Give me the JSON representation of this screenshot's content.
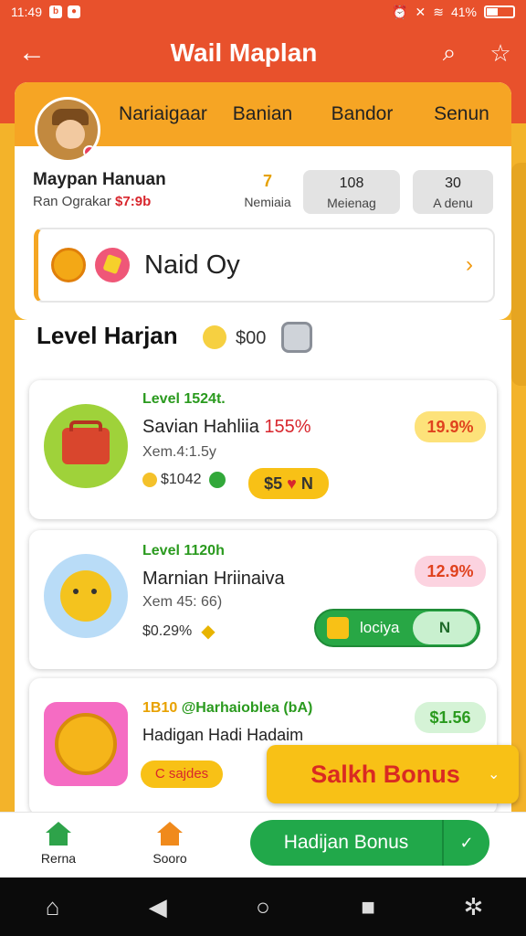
{
  "status_bar": {
    "time": "11:49",
    "notif": "b",
    "battery": "41%"
  },
  "app_bar": {
    "title": "Wail Maplan"
  },
  "profile": {
    "tabs": [
      "Nariaigaar",
      "Banian",
      "Bandor",
      "Senun"
    ],
    "name": "Maypan Hanuan",
    "sub_label": "Ran Ograkar",
    "sub_money": "$7:9b",
    "stats": [
      {
        "value": "7",
        "label": "Nemiaia"
      },
      {
        "value": "108",
        "label": "Meienag"
      },
      {
        "value": "30",
        "label": "A denu"
      }
    ]
  },
  "promo": {
    "text": "Naid Oy"
  },
  "section": {
    "title": "Level Harjan",
    "amount": "$00"
  },
  "items": [
    {
      "level": "Level 1524t.",
      "title": "Savian Hahliia",
      "pct": "155%",
      "sub": "Xem.4:1.5y",
      "price": "$1042",
      "badge": "$5",
      "badge_extra": "N",
      "tag": "19.9%"
    },
    {
      "level": "Level 1120h",
      "title": "Marnian Hriinaiva",
      "sub": "Xem 45: 66)",
      "price": "$0.29%",
      "toggle_label": "lociya",
      "toggle_state": "N",
      "tag": "12.9%"
    },
    {
      "level": "@Harhaioblea (bA)",
      "level_prefix": "1B10",
      "title": "Hadigan Hadi Hadaim",
      "badge": "C sajdes",
      "tag": "$1.56"
    }
  ],
  "float_bonus": {
    "label": "Salkh Bonus"
  },
  "bottom_nav": {
    "items": [
      "Rerna",
      "Sooro"
    ],
    "bonus_label": "Hadijan Bonus"
  },
  "colors": {
    "primary": "#e8512c",
    "accent": "#f6a524",
    "success": "#21a84a",
    "price_red": "#d8262d"
  }
}
